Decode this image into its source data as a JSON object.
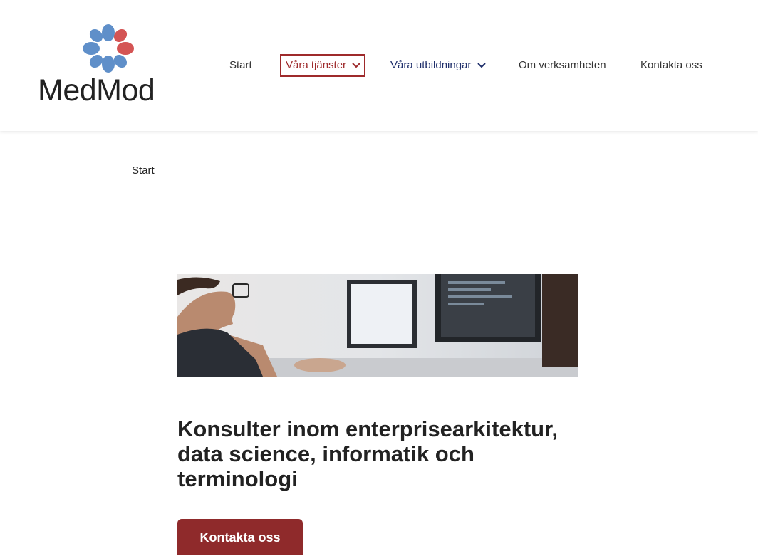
{
  "brand": {
    "name": "MedMod"
  },
  "nav": {
    "items": [
      {
        "label": "Start"
      },
      {
        "label": "Våra tjänster"
      },
      {
        "label": "Våra utbildningar"
      },
      {
        "label": "Om verksamheten"
      },
      {
        "label": "Kontakta oss"
      }
    ]
  },
  "breadcrumb": {
    "current": "Start"
  },
  "main": {
    "title": "Konsulter inom enterprisearkitektur, data science, informatik och terminologi",
    "cta_label": "Kontakta oss"
  },
  "colors": {
    "brand_red": "#9e2a2b",
    "brand_blue": "#5f8fc9",
    "nav_blue": "#1f2f6b",
    "cta": "#8f2a2b"
  }
}
